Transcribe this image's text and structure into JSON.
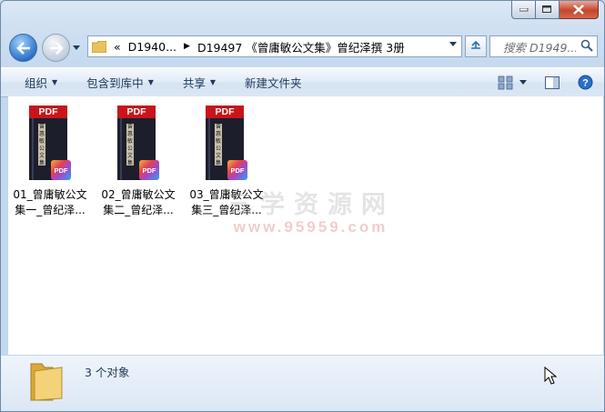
{
  "window": {
    "caption_buttons": {
      "minimize_icon": "minimize-icon",
      "maximize_icon": "maximize-icon",
      "close_icon": "close-icon"
    }
  },
  "nav": {
    "back_icon": "back-arrow-icon",
    "forward_icon": "forward-arrow-icon",
    "address": {
      "overflow": "«",
      "crumb1": "D1940...",
      "crumb2": "D19497 《曾庸敏公文集》曾纪泽撰 3册"
    },
    "search_placeholder": "搜索 D1949..."
  },
  "toolbar": {
    "organize": "组织",
    "include_in_library": "包含到库中",
    "share": "共享",
    "new_folder": "新建文件夹"
  },
  "files": [
    {
      "name": "01_曾庸敏公文集一_曾纪泽...",
      "cover_label": "曾惠敏公文集",
      "type_label": "PDF",
      "badge": "PDF"
    },
    {
      "name": "02_曾庸敏公文集二_曾纪泽...",
      "cover_label": "曾惠敏公文集",
      "type_label": "PDF",
      "badge": "PDF"
    },
    {
      "name": "03_曾庸敏公文集三_曾纪泽...",
      "cover_label": "曾惠敏公文集",
      "type_label": "PDF",
      "badge": "PDF"
    }
  ],
  "watermark": {
    "line1": "三学资源网",
    "line2": "www.95959.com"
  },
  "details": {
    "count": "3 个对象"
  },
  "colors": {
    "accent": "#1e395b",
    "pdf_red": "#c9141b",
    "window_frame": "#c9dcef"
  }
}
